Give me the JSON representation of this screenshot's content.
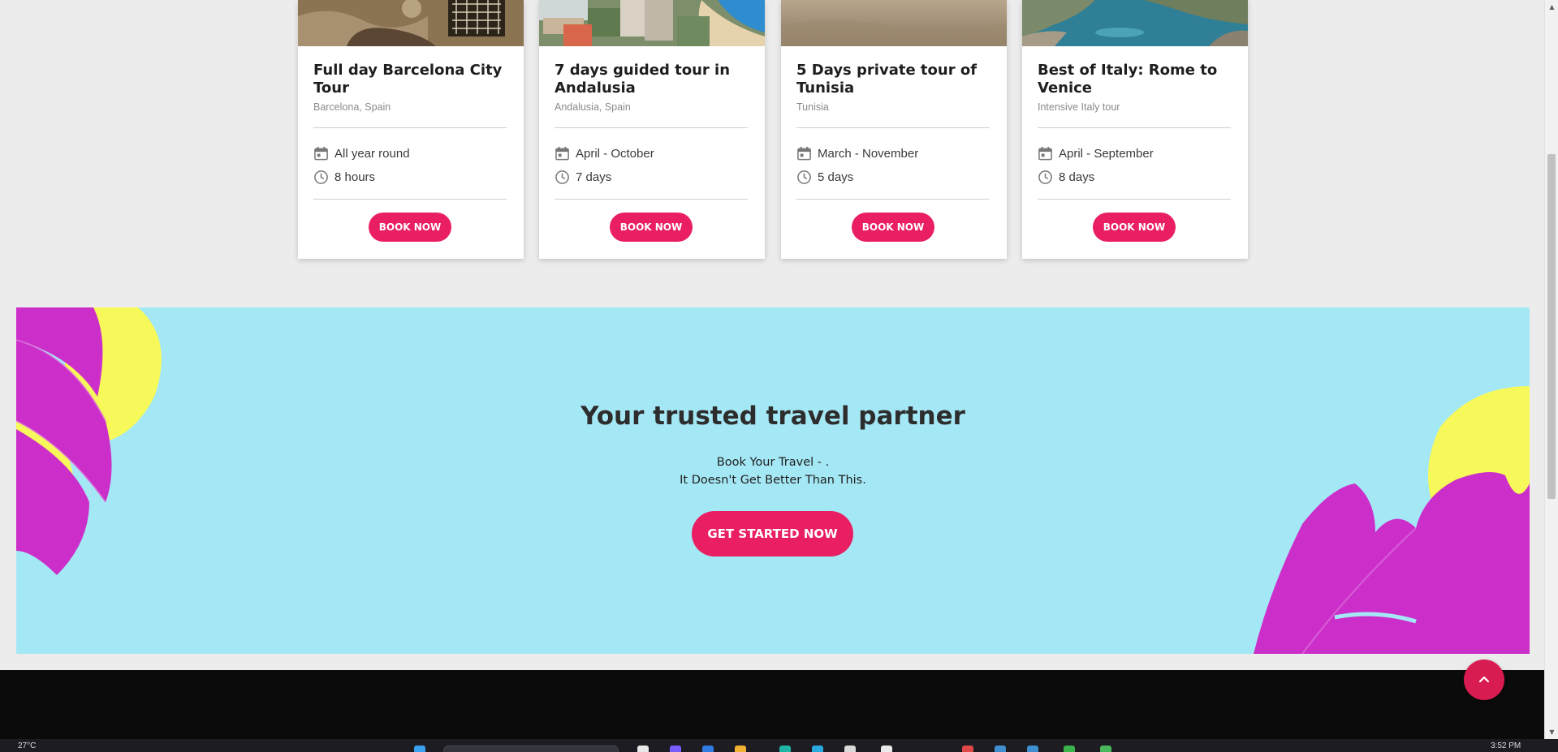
{
  "cards": [
    {
      "title": "Full day Barcelona City Tour",
      "location": "Barcelona, Spain",
      "season": "All year round",
      "duration": "8 hours",
      "button": "BOOK NOW",
      "image_theme": "barcelona-mosaic"
    },
    {
      "title": "7 days guided tour in Andalusia",
      "location": "Andalusia, Spain",
      "season": "April - October",
      "duration": "7 days",
      "button": "BOOK NOW",
      "image_theme": "coastal-city"
    },
    {
      "title": "5 Days private tour of Tunisia",
      "location": "Tunisia",
      "season": "March - November",
      "duration": "5 days",
      "button": "BOOK NOW",
      "image_theme": "desert-sand"
    },
    {
      "title": "Best of Italy: Rome to Venice",
      "location": "Intensive Italy tour",
      "season": "April - September",
      "duration": "8 days",
      "button": "BOOK NOW",
      "image_theme": "rocky-sea"
    }
  ],
  "banner": {
    "heading": "Your trusted travel partner",
    "line1": "Book Your Travel - .",
    "line2": "It Doesn't Get Better Than This.",
    "cta": "GET STARTED NOW"
  },
  "taskbar": {
    "weather": "27°C",
    "clock": "3:52 PM"
  },
  "colors": {
    "accent": "#e91e63",
    "banner_bg": "#a5e8f5",
    "page_bg": "#ececec",
    "footer_bg": "#0b0b0c",
    "leaf_magenta": "#cc2fc9",
    "leaf_yellow": "#f7f95a"
  },
  "icons": {
    "season": "calendar-icon",
    "duration": "clock-icon",
    "back_to_top": "chevron-up-icon"
  }
}
